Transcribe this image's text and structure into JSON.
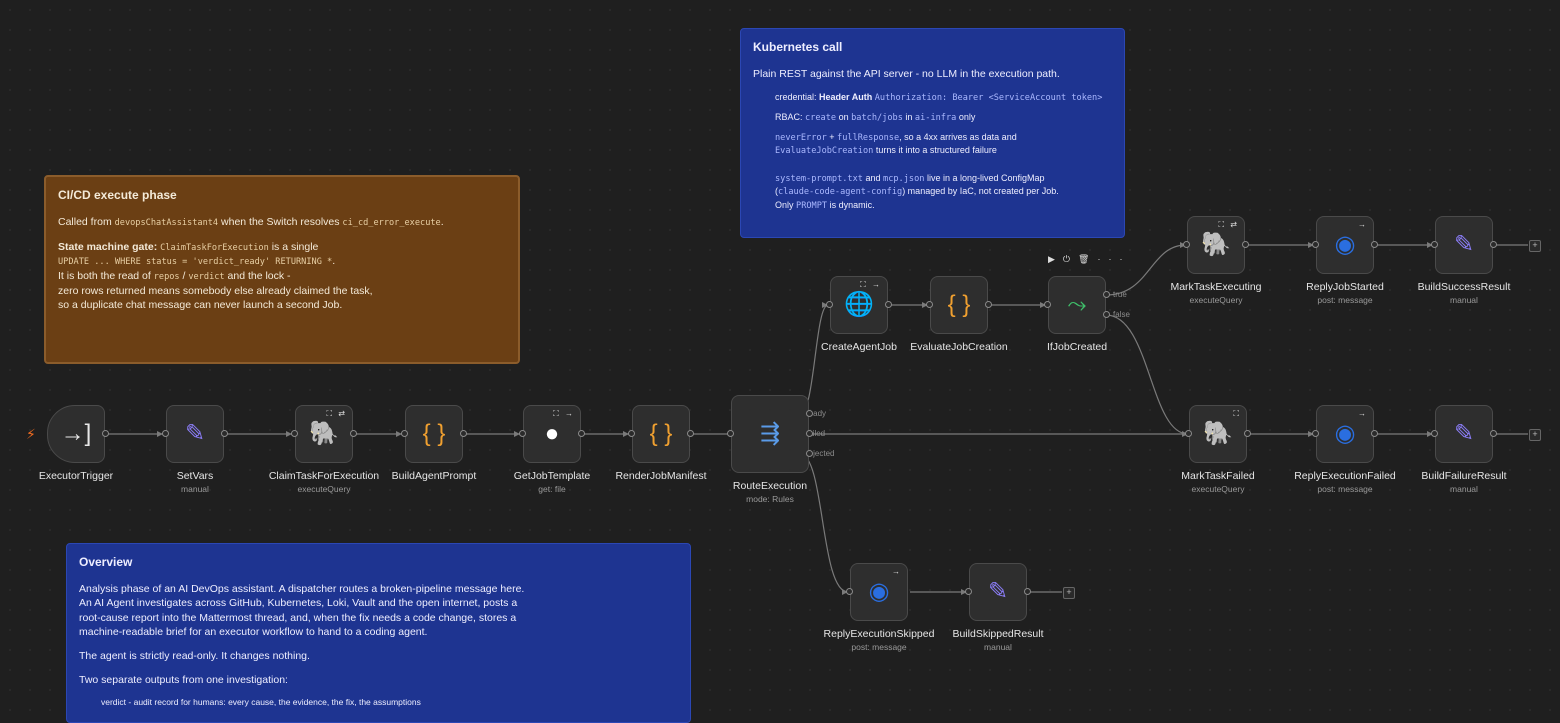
{
  "notes": {
    "k8s": {
      "title": "Kubernetes call",
      "intro": "Plain REST against the API server - no LLM in the execution path.",
      "cred_prefix": "credential:",
      "cred_bold": "Header Auth",
      "cred_code": "Authorization: Bearer <ServiceAccount token>",
      "rbac_prefix": "RBAC:",
      "rbac_c1": "create",
      "rbac_on": "on",
      "rbac_c2": "batch/jobs",
      "rbac_in": "in",
      "rbac_c3": "ai-infra",
      "rbac_suffix": "only",
      "never_c1": "neverError",
      "never_plus": "+",
      "never_c2": "fullResponse",
      "never_suffix": ", so a 4xx arrives as data and",
      "never_c3": "EvaluateJobCreation",
      "never_suffix2": "turns it into a structured failure",
      "cfg_c1": "system-prompt.txt",
      "cfg_and": "and",
      "cfg_c2": "mcp.json",
      "cfg_suffix": "live in a long-lived ConfigMap",
      "cfg_open": "(",
      "cfg_c3": "claude-code-agent-config",
      "cfg_suffix2": ") managed by IaC, not created per Job.",
      "cfg_only": "Only",
      "cfg_c4": "PROMPT",
      "cfg_suffix3": "is dynamic."
    },
    "cicd": {
      "title": "CI/CD execute phase",
      "called_prefix": "Called from",
      "called_c1": "devopsChatAssistant4",
      "called_mid": "when the Switch resolves",
      "called_c2": "ci_cd_error_execute",
      "called_end": ".",
      "gate_bold": "State machine gate:",
      "gate_c1": "ClaimTaskForExecution",
      "gate_suffix": "is a single",
      "gate_code": "UPDATE ... WHERE status = 'verdict_ready' RETURNING *",
      "gate_end": ".",
      "lock_prefix": "It is both the read of",
      "lock_c1": "repos",
      "lock_slash": "/",
      "lock_c2": "verdict",
      "lock_suffix": "and the lock -",
      "line4": "zero rows returned means somebody else already claimed the task,",
      "line5": "so a duplicate chat message can never launch a second Job."
    },
    "overview": {
      "title": "Overview",
      "p1_l1": "Analysis phase of an AI DevOps assistant. A dispatcher routes a broken-pipeline message here.",
      "p1_l2": "An AI Agent investigates across GitHub, Kubernetes, Loki, Vault and the open internet, posts a",
      "p1_l3": "root-cause report into the Mattermost thread, and, when the fix needs a code change, stores a",
      "p1_l4": "machine-readable brief for an executor workflow to hand to a coding agent.",
      "p2": "The agent is strictly read-only. It changes nothing.",
      "p3": "Two separate outputs from one investigation:",
      "bullet1": "verdict - audit record for humans: every cause, the evidence, the fix, the assumptions"
    }
  },
  "nodes": [
    {
      "id": "executor-trigger",
      "label": "ExecutorTrigger",
      "sub": "",
      "icon": "trigger-icon",
      "glyph": "→]",
      "color": "#e8e8e8",
      "badge": ""
    },
    {
      "id": "set-vars",
      "label": "SetVars",
      "sub": "manual",
      "icon": "edit-icon",
      "glyph": "✎",
      "color": "#8a7cf5",
      "badge": ""
    },
    {
      "id": "claim-task",
      "label": "ClaimTaskForExecution",
      "sub": "executeQuery",
      "icon": "postgres-icon",
      "glyph": "🐘",
      "color": "#5a9be8",
      "badge": "⛶ ⇄"
    },
    {
      "id": "build-agent-prompt",
      "label": "BuildAgentPrompt",
      "sub": "",
      "icon": "code-braces-icon",
      "glyph": "{ }",
      "color": "#f0a030",
      "badge": ""
    },
    {
      "id": "get-job-template",
      "label": "GetJobTemplate",
      "sub": "get: file",
      "icon": "github-icon",
      "glyph": "●",
      "color": "#ffffff",
      "badge": "⛶ →"
    },
    {
      "id": "render-job-manifest",
      "label": "RenderJobManifest",
      "sub": "",
      "icon": "code-braces-icon",
      "glyph": "{ }",
      "color": "#f0a030",
      "badge": ""
    },
    {
      "id": "route-execution",
      "label": "RouteExecution",
      "sub": "mode: Rules",
      "icon": "switch-icon",
      "glyph": "⇶",
      "color": "#5a9be8",
      "badge": ""
    },
    {
      "id": "create-agent-job",
      "label": "CreateAgentJob",
      "sub": "",
      "icon": "globe-icon",
      "glyph": "🌐",
      "color": "#8a7cf5",
      "badge": "⛶ →"
    },
    {
      "id": "evaluate-job-creation",
      "label": "EvaluateJobCreation",
      "sub": "",
      "icon": "code-braces-icon",
      "glyph": "{ }",
      "color": "#f0a030",
      "badge": ""
    },
    {
      "id": "if-job-created",
      "label": "IfJobCreated",
      "sub": "",
      "icon": "if-branch-icon",
      "glyph": "⤳",
      "color": "#3fbf6a",
      "badge": ""
    },
    {
      "id": "mark-task-executing",
      "label": "MarkTaskExecuting",
      "sub": "executeQuery",
      "icon": "postgres-icon",
      "glyph": "🐘",
      "color": "#5a9be8",
      "badge": "⛶ ⇄"
    },
    {
      "id": "reply-job-started",
      "label": "ReplyJobStarted",
      "sub": "post: message",
      "icon": "mattermost-icon",
      "glyph": "◉",
      "color": "#2a6ee0",
      "badge": "→"
    },
    {
      "id": "build-success-result",
      "label": "BuildSuccessResult",
      "sub": "manual",
      "icon": "edit-icon",
      "glyph": "✎",
      "color": "#8a7cf5",
      "badge": ""
    },
    {
      "id": "mark-task-failed",
      "label": "MarkTaskFailed",
      "sub": "executeQuery",
      "icon": "postgres-icon",
      "glyph": "🐘",
      "color": "#5a9be8",
      "badge": "⛶"
    },
    {
      "id": "reply-execution-failed",
      "label": "ReplyExecutionFailed",
      "sub": "post: message",
      "icon": "mattermost-icon",
      "glyph": "◉",
      "color": "#2a6ee0",
      "badge": "→"
    },
    {
      "id": "build-failure-result",
      "label": "BuildFailureResult",
      "sub": "manual",
      "icon": "edit-icon",
      "glyph": "✎",
      "color": "#8a7cf5",
      "badge": ""
    },
    {
      "id": "reply-execution-skipped",
      "label": "ReplyExecutionSkipped",
      "sub": "post: message",
      "icon": "mattermost-icon",
      "glyph": "◉",
      "color": "#2a6ee0",
      "badge": "→"
    },
    {
      "id": "build-skipped-result",
      "label": "BuildSkippedResult",
      "sub": "manual",
      "icon": "edit-icon",
      "glyph": "✎",
      "color": "#8a7cf5",
      "badge": ""
    }
  ],
  "outputs": {
    "ready": "ready",
    "failed": "failed",
    "rejected": "rejected",
    "true": "true",
    "false": "false"
  },
  "toolbar": {
    "play": "▶",
    "power": "⏻",
    "delete": "🗑",
    "more": "···"
  },
  "plus": "+"
}
